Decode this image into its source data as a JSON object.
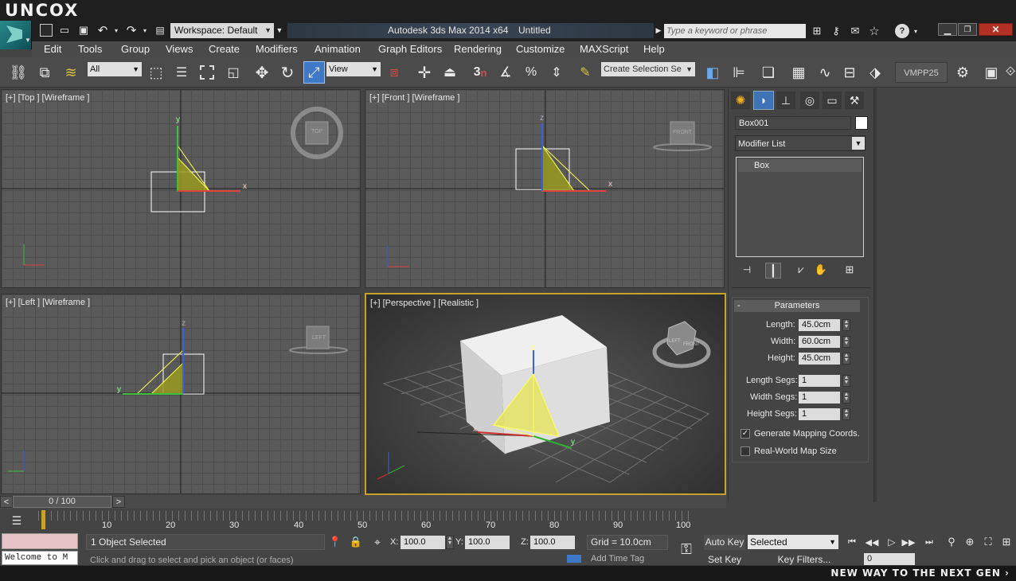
{
  "brand": {
    "watermark": "UNCOX",
    "tagline": "NEW WAY TO THE NEXT GEN ›"
  },
  "titlebar": {
    "workspace": "Workspace: Default",
    "app_title": "Autodesk 3ds Max  2014 x64",
    "document": "Untitled",
    "search_placeholder": "Type a keyword or phrase"
  },
  "menu": [
    "Edit",
    "Tools",
    "Group",
    "Views",
    "Create",
    "Modifiers",
    "Animation",
    "Graph Editors",
    "Rendering",
    "Customize",
    "MAXScript",
    "Help"
  ],
  "toolbar": {
    "filter_select": "All",
    "ref_coord": "View",
    "selection_set": "Create Selection Se",
    "snap_3": "3",
    "snap_n": "n",
    "vmpp": "VMPP25"
  },
  "viewports": {
    "top": {
      "label": "[+] [Top ] [Wireframe ]",
      "cube": "TOP"
    },
    "front": {
      "label": "[+] [Front ] [Wireframe ]",
      "cube": "FRONT"
    },
    "left": {
      "label": "[+] [Left ] [Wireframe ]",
      "cube": "LEFT"
    },
    "perspective": {
      "label": "[+] [Perspective ] [Realistic ]",
      "cube_a": "LEFT",
      "cube_b": "FRONT"
    },
    "axes": {
      "x": "x",
      "y": "y",
      "z": "z"
    }
  },
  "command_panel": {
    "object_name": "Box001",
    "object_color": "#ffffff",
    "modifier_list": "Modifier List",
    "stack_item": "Box",
    "rollout_toggle": "-",
    "rollout_title": "Parameters",
    "params": [
      {
        "label": "Length:",
        "value": "45.0cm"
      },
      {
        "label": "Width:",
        "value": "60.0cm"
      },
      {
        "label": "Height:",
        "value": "45.0cm"
      },
      {
        "label": "Length Segs:",
        "value": "1"
      },
      {
        "label": "Width Segs:",
        "value": "1"
      },
      {
        "label": "Height Segs:",
        "value": "1"
      }
    ],
    "generate_mapping": {
      "label": "Generate Mapping Coords.",
      "checked": true
    },
    "real_world": {
      "label": "Real-World Map Size",
      "checked": false
    }
  },
  "timeline": {
    "slider": "0 / 100",
    "prev": "<",
    "next": ">",
    "ticks": [
      "10",
      "20",
      "30",
      "40",
      "50",
      "60",
      "70",
      "80",
      "90",
      "100"
    ]
  },
  "status": {
    "listener": "Welcome to M",
    "selection": "1 Object Selected",
    "hint": "Click and drag to select and pick an object (or faces)",
    "x_label": "X:",
    "x": "100.0",
    "y_label": "Y:",
    "y": "100.0",
    "z_label": "Z:",
    "z": "100.0",
    "grid": "Grid = 10.0cm",
    "auto_key": "Auto Key",
    "set_key": "Set Key",
    "key_select": "Selected",
    "key_filters": "Key Filters...",
    "frame": "0",
    "add_time_tag": "Add Time Tag"
  },
  "colors": {
    "accent": "#2c8fa0",
    "selection_yellow": "#e8e800",
    "active_border": "#c8a32a"
  }
}
